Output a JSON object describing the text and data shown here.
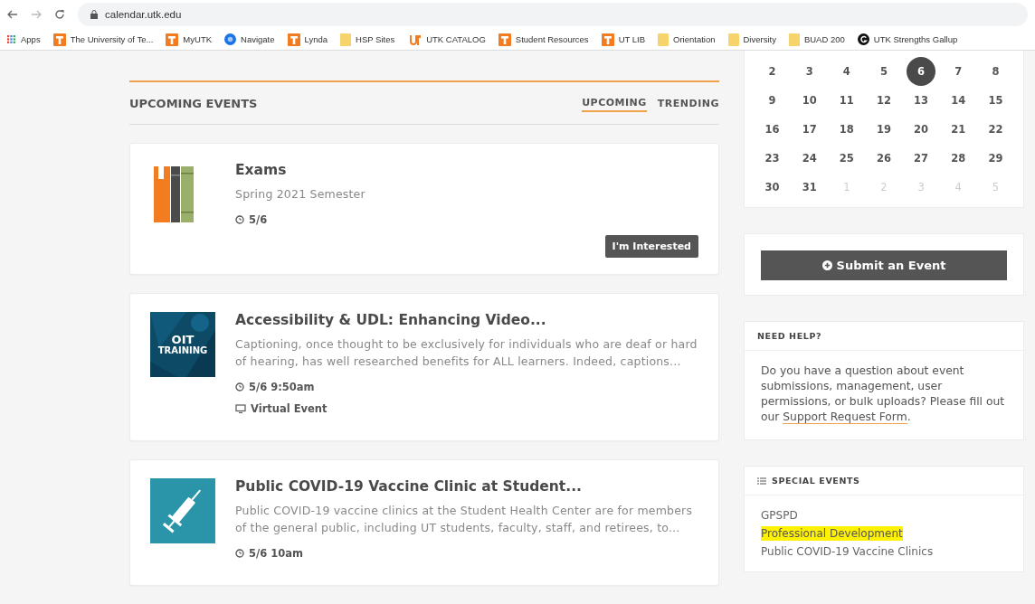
{
  "browser": {
    "address": "calendar.utk.edu",
    "bookmarks": [
      {
        "label": "Apps",
        "kind": "apps"
      },
      {
        "label": "The University of Te...",
        "kind": "ut"
      },
      {
        "label": "MyUTK",
        "kind": "ut"
      },
      {
        "label": "Navigate",
        "kind": "circle"
      },
      {
        "label": "Lynda",
        "kind": "ut"
      },
      {
        "label": "HSP Sites",
        "kind": "folder"
      },
      {
        "label": "UTK CATALOG",
        "kind": "catalog"
      },
      {
        "label": "Student Resources",
        "kind": "ut"
      },
      {
        "label": "UT LIB",
        "kind": "ut"
      },
      {
        "label": "Orientation",
        "kind": "folder"
      },
      {
        "label": "Diversity",
        "kind": "folder"
      },
      {
        "label": "BUAD 200",
        "kind": "folder"
      },
      {
        "label": "UTK Strengths Gallup",
        "kind": "gallup"
      }
    ]
  },
  "events_header": {
    "title": "UPCOMING EVENTS",
    "tabs": [
      {
        "label": "UPCOMING",
        "selected": true
      },
      {
        "label": "TRENDING",
        "selected": false
      }
    ]
  },
  "events": [
    {
      "kind": "books",
      "title": "Exams",
      "description": "Spring 2021 Semester",
      "time": "5/6",
      "button": "I'm Interested"
    },
    {
      "kind": "oit",
      "thumb_text": [
        "OIT",
        "TRAINING"
      ],
      "title": "Accessibility & UDL: Enhancing Video...",
      "description": "Captioning, once thought to be exclusively for individuals who are deaf or hard of hearing, has well researched benefits for ALL learners. Indeed, captions...",
      "time": "5/6 9:50am",
      "location": "Virtual Event"
    },
    {
      "kind": "syringe",
      "title": "Public COVID-19 Vaccine Clinic at Student...",
      "description": "Public COVID-19 vaccine clinics at the Student Health Center are for members of the general public, including UT students, faculty, staff, and retirees, to...",
      "time": "5/6 10am"
    }
  ],
  "calendar": {
    "weeks": [
      [
        {
          "day": "2",
          "selected": false,
          "muted": false
        },
        {
          "day": "3",
          "selected": false,
          "muted": false
        },
        {
          "day": "4",
          "selected": false,
          "muted": false
        },
        {
          "day": "5",
          "selected": false,
          "muted": false
        },
        {
          "day": "6",
          "selected": true,
          "muted": false
        },
        {
          "day": "7",
          "selected": false,
          "muted": false
        },
        {
          "day": "8",
          "selected": false,
          "muted": false
        }
      ],
      [
        {
          "day": "9",
          "selected": false,
          "muted": false
        },
        {
          "day": "10",
          "selected": false,
          "muted": false
        },
        {
          "day": "11",
          "selected": false,
          "muted": false
        },
        {
          "day": "12",
          "selected": false,
          "muted": false
        },
        {
          "day": "13",
          "selected": false,
          "muted": false
        },
        {
          "day": "14",
          "selected": false,
          "muted": false
        },
        {
          "day": "15",
          "selected": false,
          "muted": false
        }
      ],
      [
        {
          "day": "16",
          "selected": false,
          "muted": false
        },
        {
          "day": "17",
          "selected": false,
          "muted": false
        },
        {
          "day": "18",
          "selected": false,
          "muted": false
        },
        {
          "day": "19",
          "selected": false,
          "muted": false
        },
        {
          "day": "20",
          "selected": false,
          "muted": false
        },
        {
          "day": "21",
          "selected": false,
          "muted": false
        },
        {
          "day": "22",
          "selected": false,
          "muted": false
        }
      ],
      [
        {
          "day": "23",
          "selected": false,
          "muted": false
        },
        {
          "day": "24",
          "selected": false,
          "muted": false
        },
        {
          "day": "25",
          "selected": false,
          "muted": false
        },
        {
          "day": "26",
          "selected": false,
          "muted": false
        },
        {
          "day": "27",
          "selected": false,
          "muted": false
        },
        {
          "day": "28",
          "selected": false,
          "muted": false
        },
        {
          "day": "29",
          "selected": false,
          "muted": false
        }
      ],
      [
        {
          "day": "30",
          "selected": false,
          "muted": false
        },
        {
          "day": "31",
          "selected": false,
          "muted": false
        },
        {
          "day": "1",
          "selected": false,
          "muted": true
        },
        {
          "day": "2",
          "selected": false,
          "muted": true
        },
        {
          "day": "3",
          "selected": false,
          "muted": true
        },
        {
          "day": "4",
          "selected": false,
          "muted": true
        },
        {
          "day": "5",
          "selected": false,
          "muted": true
        }
      ]
    ]
  },
  "submit_button": "Submit an Event",
  "help": {
    "title": "NEED HELP?",
    "text": "Do you have a question about event submissions, management, user permissions, or bulk uploads? Please fill out our",
    "link": "Support Request Form",
    "after": "."
  },
  "special_events": {
    "title": "SPECIAL EVENTS",
    "items": [
      {
        "label": "GPSPD",
        "highlighted": false
      },
      {
        "label": "Professional Development",
        "highlighted": true
      },
      {
        "label": "Public COVID-19 Vaccine Clinics",
        "highlighted": false
      }
    ]
  }
}
